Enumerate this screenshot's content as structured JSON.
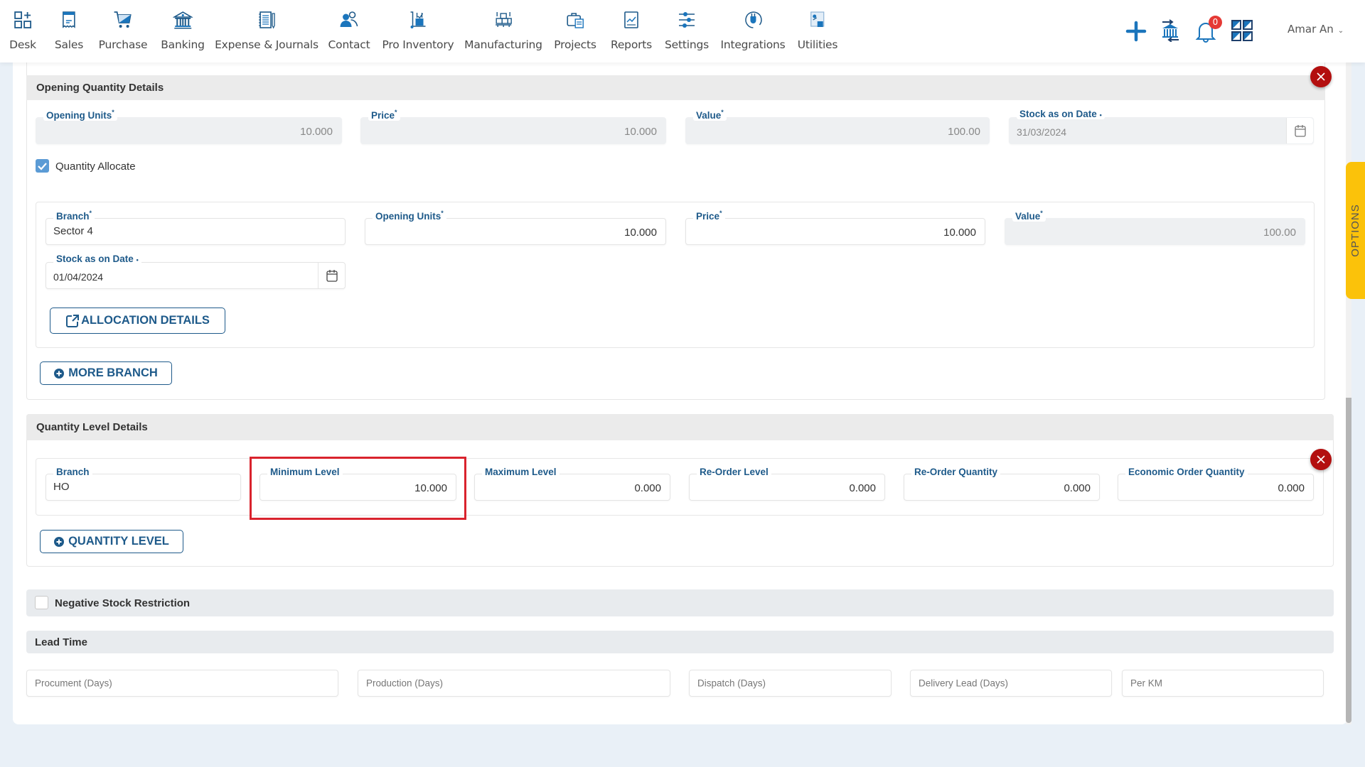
{
  "nav": {
    "items": [
      {
        "label": "Desk",
        "icon": "desk-icon"
      },
      {
        "label": "Sales",
        "icon": "sales-receipt-icon"
      },
      {
        "label": "Purchase",
        "icon": "cart-icon"
      },
      {
        "label": "Banking",
        "icon": "bank-icon"
      },
      {
        "label": "Expense & Journals",
        "icon": "notebook-icon"
      },
      {
        "label": "Contact",
        "icon": "contacts-icon"
      },
      {
        "label": "Pro Inventory",
        "icon": "inventory-trolley-icon"
      },
      {
        "label": "Manufacturing",
        "icon": "manufacturing-icon"
      },
      {
        "label": "Projects",
        "icon": "briefcase-icon"
      },
      {
        "label": "Reports",
        "icon": "report-chart-icon"
      },
      {
        "label": "Settings",
        "icon": "sliders-icon"
      },
      {
        "label": "Integrations",
        "icon": "plug-icon"
      },
      {
        "label": "Utilities",
        "icon": "utilities-icon"
      }
    ],
    "notification_count": "0",
    "user_name": "Amar An"
  },
  "opening": {
    "title": "Opening Quantity Details",
    "opening_units_label": "Opening Units",
    "opening_units": "10.000",
    "price_label": "Price",
    "price": "10.000",
    "value_label": "Value",
    "value": "100.00",
    "stock_date_label": "Stock as on Date",
    "stock_date": "31/03/2024",
    "quantity_allocate_label": "Quantity Allocate",
    "quantity_allocate_checked": true,
    "branch_row": {
      "branch_label": "Branch",
      "branch": "Sector 4",
      "opening_units_label": "Opening Units",
      "opening_units": "10.000",
      "price_label": "Price",
      "price": "10.000",
      "value_label": "Value",
      "value": "100.00",
      "stock_date_label": "Stock as on Date",
      "stock_date": "01/04/2024"
    },
    "allocation_details_label": "ALLOCATION DETAILS",
    "more_branch_label": "MORE BRANCH",
    "required_mark": "*",
    "required_dot": "•"
  },
  "quantity_level": {
    "title": "Quantity Level Details",
    "fields": [
      {
        "label": "Branch",
        "value": "HO"
      },
      {
        "label": "Minimum Level",
        "value": "10.000"
      },
      {
        "label": "Maximum Level",
        "value": "0.000"
      },
      {
        "label": "Re-Order Level",
        "value": "0.000"
      },
      {
        "label": "Re-Order Quantity",
        "value": "0.000"
      },
      {
        "label": "Economic Order Quantity",
        "value": "0.000"
      }
    ],
    "add_button_label": "QUANTITY LEVEL"
  },
  "negative_stock": {
    "label": "Negative Stock Restriction",
    "checked": false
  },
  "lead_time": {
    "title": "Lead Time",
    "placeholders": [
      "Procument (Days)",
      "Production (Days)",
      "Dispatch (Days)",
      "Delivery Lead (Days)",
      "Per KM"
    ]
  },
  "options_tab_label": "OPTIONS",
  "colors": {
    "primary": "#1e5a8a",
    "accent_blue": "#1b75bc",
    "danger": "#b30f0f",
    "highlight": "#d9232d",
    "options_tab": "#fbc20a"
  }
}
